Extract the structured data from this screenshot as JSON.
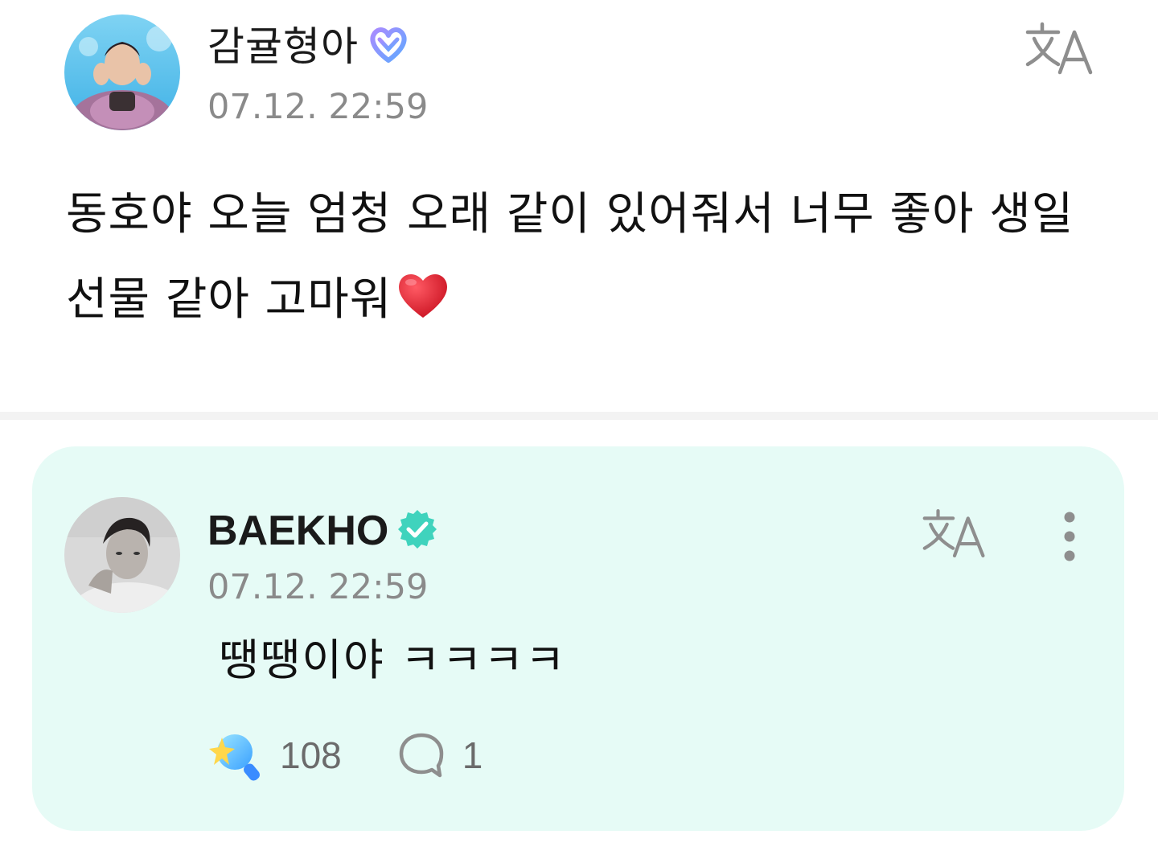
{
  "post": {
    "author": "감귤형아",
    "timestamp": "07.12. 22:59",
    "text_line1": "동호야 오늘 엄청 오래 같이 있어줘서 너무 좋아 생일",
    "text_line2": "선물 같아 고마워",
    "emoji": "heart-emoji"
  },
  "reply": {
    "author": "BAEKHO",
    "timestamp": "07.12. 22:59",
    "text": "땡땡이야 ㅋㅋㅋㅋ",
    "like_count": "108",
    "comment_count": "1"
  },
  "colors": {
    "reply_background": "#e6fbf6",
    "verified_badge": "#3fd3bd",
    "fan_badge_start": "#a98bff",
    "fan_badge_end": "#5fa9ff",
    "heart": "#e02434",
    "timestamp": "#8a8a8a",
    "icon_gray": "#8e8e8e"
  },
  "icons": {
    "translate": "translate-icon",
    "more": "more-vertical-icon",
    "like": "star-wand-icon",
    "comment": "comment-bubble-icon",
    "verified": "verified-badge-icon",
    "fan_badge": "fan-heart-badge-icon"
  }
}
